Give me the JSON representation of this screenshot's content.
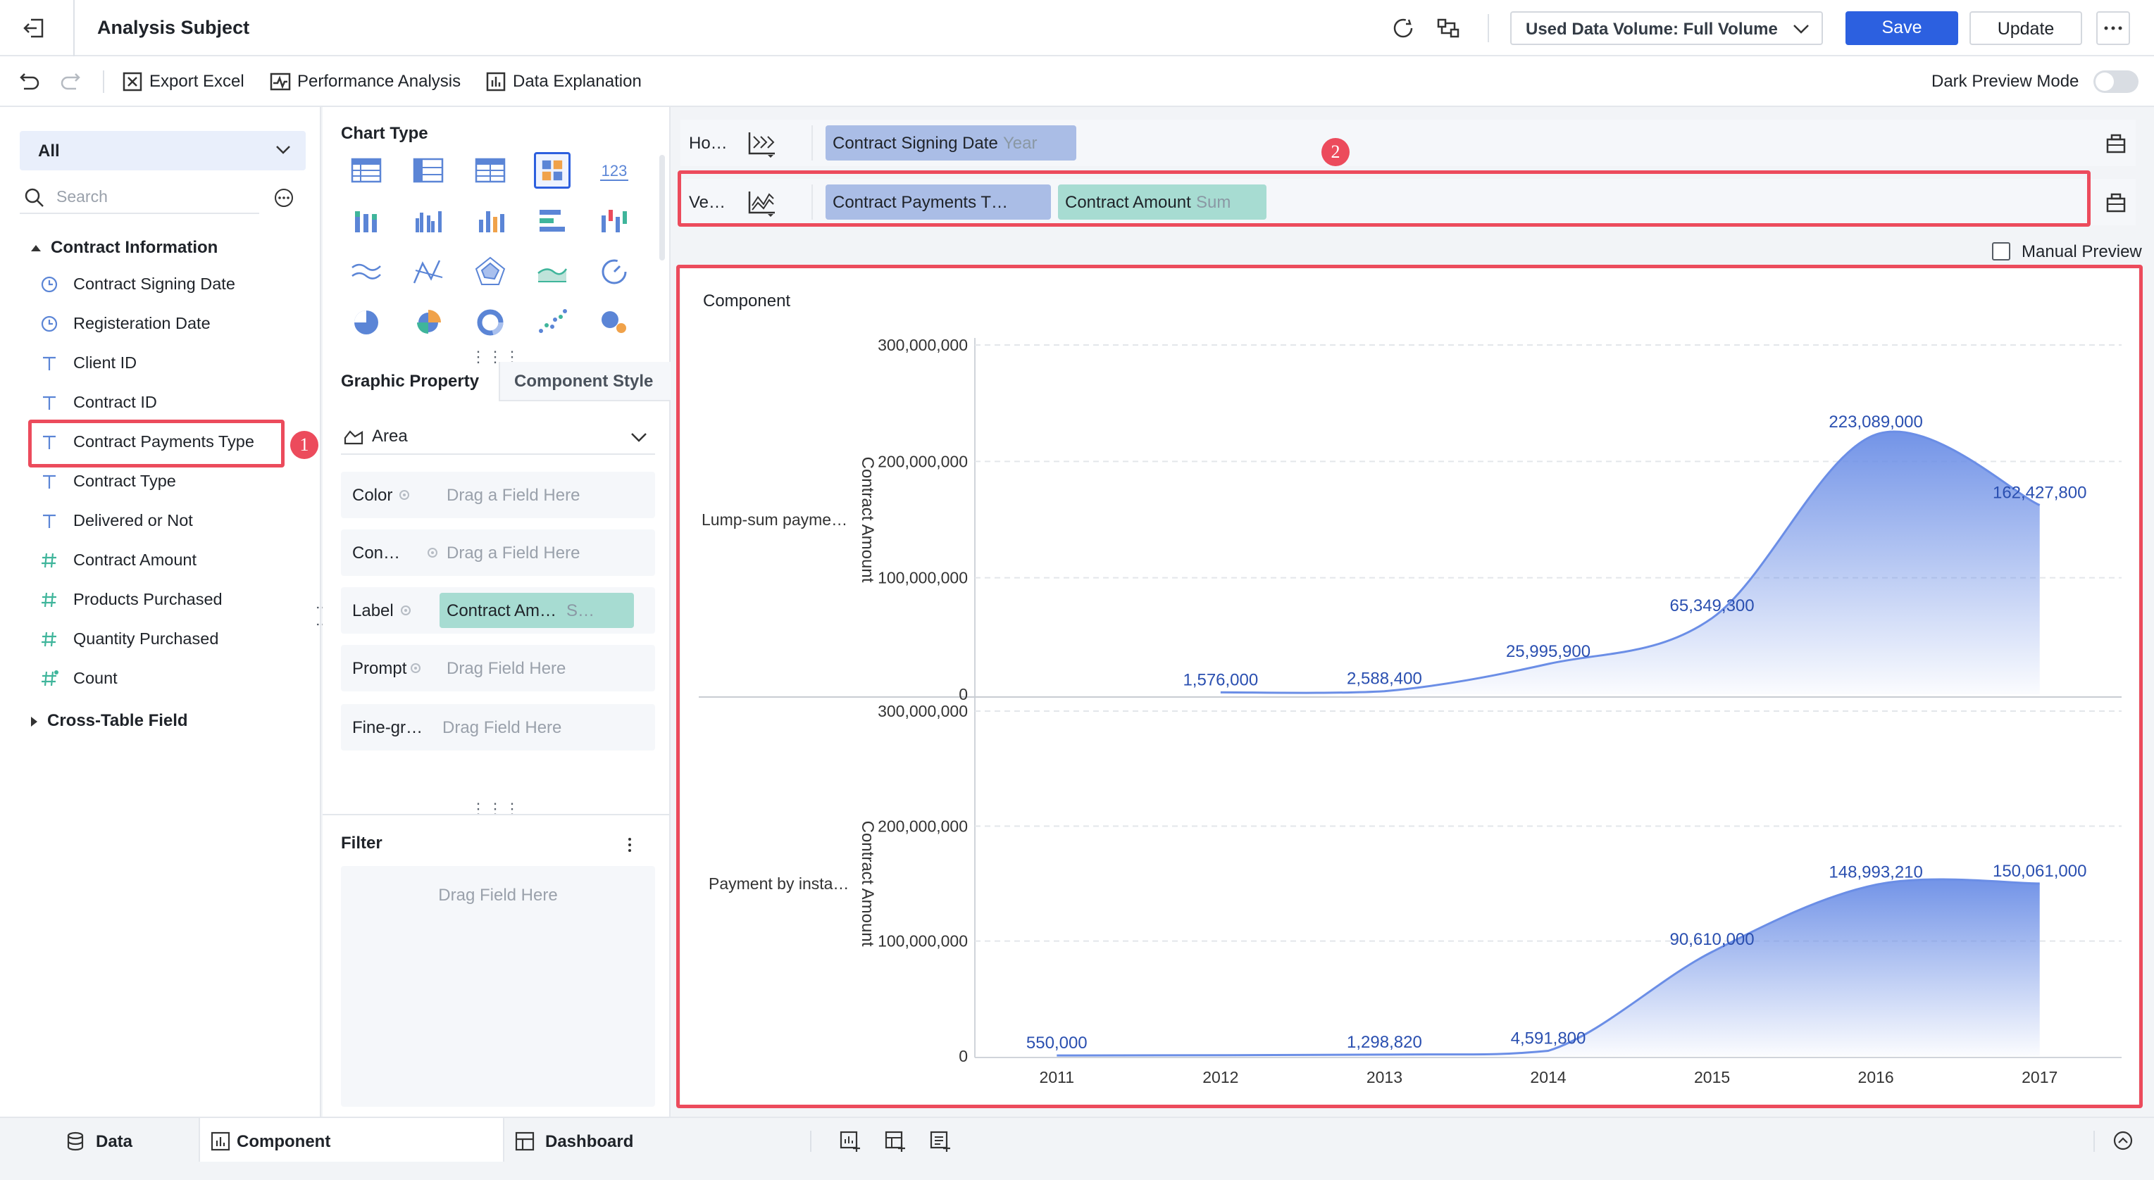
{
  "header": {
    "title": "Analysis Subject",
    "volume_label": "Used Data Volume: Full Volume",
    "save_label": "Save",
    "update_label": "Update"
  },
  "toolbar": {
    "export_label": "Export Excel",
    "performance_label": "Performance Analysis",
    "explanation_label": "Data Explanation",
    "dark_mode_label": "Dark Preview Mode"
  },
  "fields": {
    "selector": "All",
    "search_placeholder": "Search",
    "group_label": "Contract Information",
    "items": [
      {
        "label": "Contract Signing Date",
        "icon": "clock-icon"
      },
      {
        "label": "Registeration Date",
        "icon": "clock-icon"
      },
      {
        "label": "Client ID",
        "icon": "text-type-icon"
      },
      {
        "label": "Contract ID",
        "icon": "text-type-icon"
      },
      {
        "label": "Contract Payments Type",
        "icon": "text-type-icon"
      },
      {
        "label": "Contract Type",
        "icon": "text-type-icon"
      },
      {
        "label": "Delivered or Not",
        "icon": "text-type-icon"
      },
      {
        "label": "Contract Amount",
        "icon": "hash-icon"
      },
      {
        "label": "Products Purchased",
        "icon": "hash-icon"
      },
      {
        "label": "Quantity Purchased",
        "icon": "hash-icon"
      },
      {
        "label": "Count",
        "icon": "hash-icon"
      }
    ],
    "group2_label": "Cross-Table Field"
  },
  "annotations": {
    "badge1": "1",
    "badge2": "2"
  },
  "chart_type": {
    "title": "Chart Type",
    "number_icon_text": "123"
  },
  "graphic": {
    "tab_property": "Graphic Property",
    "tab_style": "Component Style",
    "mark_type": "Area",
    "props": [
      {
        "label": "Color",
        "placeholder": "Drag a Field Here"
      },
      {
        "label": "Con…",
        "placeholder": "Drag a Field Here"
      },
      {
        "label": "Label",
        "chip_name": "Contract Am…",
        "chip_agg": "S…"
      },
      {
        "label": "Prompt",
        "placeholder": "Drag Field Here"
      },
      {
        "label": "Fine-gr…",
        "placeholder": "Drag Field Here"
      }
    ]
  },
  "filter": {
    "title": "Filter",
    "placeholder": "Drag Field Here"
  },
  "shelves": {
    "horizontal_label": "Ho…",
    "horizontal_field": "Contract Signing Date",
    "horizontal_agg": "Year",
    "vertical_label": "Ve…",
    "vertical_field1": "Contract Payments T…",
    "vertical_field2": "Contract Amount",
    "vertical_field2_agg": "Sum"
  },
  "manual_preview_label": "Manual Preview",
  "component_title": "Component",
  "chart_data": {
    "type": "area",
    "categories": [
      "2011",
      "2012",
      "2013",
      "2014",
      "2015",
      "2016",
      "2017"
    ],
    "ylabel": "Contract Amount",
    "ylim": [
      0,
      300000000
    ],
    "yticks": [
      "300,000,000",
      "200,000,000",
      "100,000,000",
      "0"
    ],
    "color": "#6b8ee6",
    "series": [
      {
        "name": "Lump-sum payme…",
        "values": [
          null,
          1576000,
          2588400,
          25995900,
          65349300,
          223089000,
          162427800
        ],
        "labels": [
          "",
          "1,576,000",
          "2,588,400",
          "25,995,900",
          "65,349,300",
          "223,089,000",
          "162,427,800"
        ]
      },
      {
        "name": "Payment by insta…",
        "values": [
          550000,
          null,
          1298820,
          4591800,
          90610000,
          148993210,
          150061000
        ],
        "labels": [
          "550,000",
          "",
          "1,298,820",
          "4,591,800",
          "90,610,000",
          "148,993,210",
          "150,061,000"
        ]
      }
    ]
  },
  "bottom": {
    "data_tab": "Data",
    "component_tab": "Component",
    "dashboard_tab": "Dashboard"
  }
}
